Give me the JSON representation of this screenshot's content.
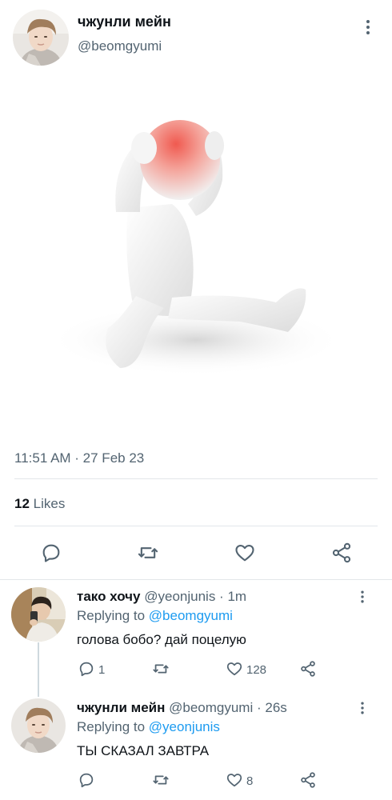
{
  "tweet": {
    "author_name": "чжунли мейн",
    "author_handle": "@beomgyumi",
    "timestamp": "11:51 AM · 27 Feb 23",
    "likes_count": "12",
    "likes_label": "Likes"
  },
  "replies": [
    {
      "author_name": "тако хочу",
      "author_handle": "@yeonjunis",
      "separator": " · ",
      "time": "1m",
      "replying_label": "Replying to",
      "replying_to": "@beomgyumi",
      "text": "голова бобо? дай поцелую",
      "reply_count": "1",
      "like_count": "128"
    },
    {
      "author_name": "чжунли мейн",
      "author_handle": "@beomgyumi",
      "separator": " · ",
      "time": "26s",
      "replying_label": "Replying to",
      "replying_to": "@yeonjunis",
      "text": "ТЫ СКАЗАЛ ЗАВТРА",
      "like_count": "8"
    }
  ],
  "icons": [
    "more-vertical-icon",
    "reply-icon",
    "retweet-icon",
    "like-icon",
    "share-icon"
  ],
  "colors": {
    "accent": "#1d9bf0",
    "secondary_text": "#536471",
    "border": "#e3e7ea"
  }
}
